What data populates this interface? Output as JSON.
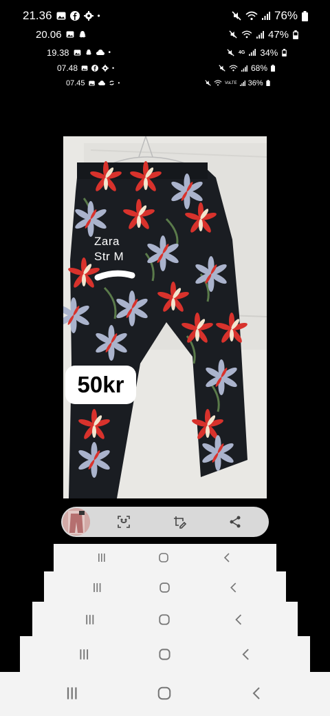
{
  "status_bars": [
    {
      "time": "21.36",
      "left_icons": [
        "image-icon",
        "facebook-icon",
        "gear-icon",
        "dot-icon"
      ],
      "battery": "76%"
    },
    {
      "time": "20.06",
      "left_icons": [
        "image-icon",
        "snapchat-icon"
      ],
      "battery": "47%"
    },
    {
      "time": "19.38",
      "left_icons": [
        "image-icon",
        "snapchat-icon",
        "cloud-icon",
        "dot-icon"
      ],
      "battery": "34%",
      "network_badge": "4G"
    },
    {
      "time": "07.48",
      "left_icons": [
        "image-icon",
        "facebook-icon",
        "gear-icon",
        "dot-icon"
      ],
      "battery": "68%"
    },
    {
      "time": "07.45",
      "left_icons": [
        "image-icon",
        "cloud-icon",
        "sync-icon",
        "dot-icon"
      ],
      "battery": "36%",
      "network_badge": "VoLTE"
    }
  ],
  "photo": {
    "handwritten_label_line1": "Zara",
    "handwritten_label_line2": "Str M",
    "price_sticker": "50kr"
  },
  "toolbar": {
    "items": [
      "thumbnail",
      "scan-icon",
      "edit-icon",
      "share-icon"
    ]
  },
  "colors": {
    "background": "#000000",
    "toolbar": "#d9d9d9",
    "navbar": "#f3f3f3",
    "pants_base": "#1a1d22",
    "flower_red": "#d8322c",
    "flower_lavender": "#aab3cc",
    "flower_cream": "#f2e6cf"
  }
}
